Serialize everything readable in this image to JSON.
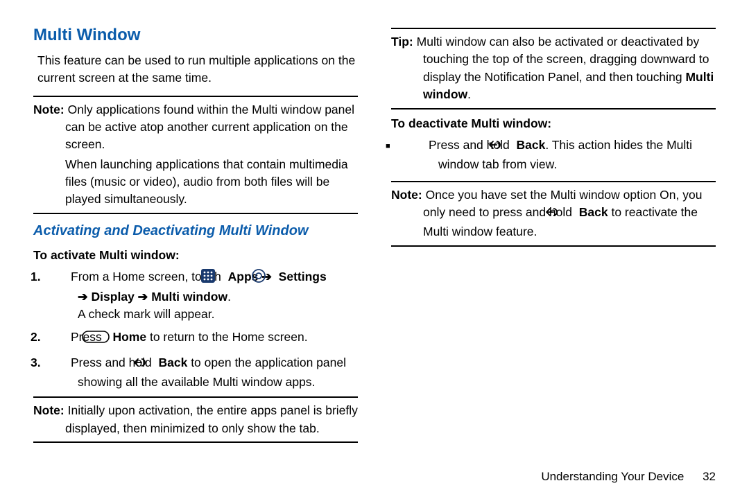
{
  "title": "Multi Window",
  "intro": "This feature can be used to run multiple applications on the current screen at the same time.",
  "note1": {
    "label": "Note:",
    "line1": "Only applications found within the Multi window panel can be active atop another current application on the screen.",
    "line2": "When launching applications that contain multimedia files (music or video), audio from both files will be played simultaneously."
  },
  "subsection": "Activating and Deactivating Multi Window",
  "activate": {
    "heading": "To activate Multi window:",
    "step1": {
      "num": "1.",
      "pre": "From a Home screen, touch ",
      "apps": "Apps",
      "settings": "Settings",
      "display": "Display",
      "mw": "Multi window",
      "post": ".",
      "line2": "A check mark will appear."
    },
    "step2": {
      "num": "2.",
      "pre": "Press ",
      "home": "Home",
      "post": " to return to the Home screen."
    },
    "step3": {
      "num": "3.",
      "pre": "Press and hold ",
      "back": "Back",
      "post": " to open the application panel showing all the available Multi window apps."
    }
  },
  "note2": {
    "label": "Note:",
    "text": "Initially upon activation, the entire apps panel is briefly displayed, then minimized to only show the tab."
  },
  "tip": {
    "label": "Tip:",
    "text": "Multi window can also be activated or deactivated by touching the top of the screen, dragging downward to display the Notification Panel, and then touching ",
    "mw": "Multi window",
    "post": "."
  },
  "deactivate": {
    "heading": "To deactivate Multi window:",
    "pre": "Press and hold ",
    "back": "Back",
    "post": ". This action hides the Multi window tab from view."
  },
  "note3": {
    "label": "Note:",
    "pre": "Once you have set the Multi window option On, you only need to press and hold ",
    "back": "Back",
    "post": " to reactivate the Multi window feature."
  },
  "footer": {
    "chapter": "Understanding Your Device",
    "page": "32"
  },
  "arrows": {
    "r": "➔"
  }
}
